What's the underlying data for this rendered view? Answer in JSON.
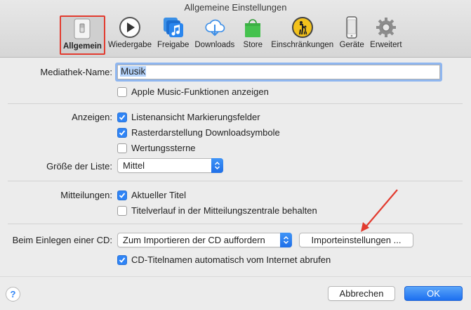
{
  "window": {
    "title": "Allgemeine Einstellungen"
  },
  "tabs": [
    {
      "label": "Allgemein",
      "icon": "switch-icon"
    },
    {
      "label": "Wiedergabe",
      "icon": "play-icon"
    },
    {
      "label": "Freigabe",
      "icon": "music-share-icon"
    },
    {
      "label": "Downloads",
      "icon": "cloud-download-icon"
    },
    {
      "label": "Store",
      "icon": "shopping-bag-icon"
    },
    {
      "label": "Einschränkungen",
      "icon": "parental-icon"
    },
    {
      "label": "Geräte",
      "icon": "phone-icon"
    },
    {
      "label": "Erweitert",
      "icon": "gear-icon"
    }
  ],
  "library": {
    "label": "Mediathek-Name:",
    "value": "Musik",
    "apple_music": "Apple Music-Funktionen anzeigen"
  },
  "show": {
    "label": "Anzeigen:",
    "options": [
      {
        "text": "Listenansicht Markierungsfelder",
        "checked": true
      },
      {
        "text": "Rasterdarstellung Downloadsymbole",
        "checked": true
      },
      {
        "text": "Wertungssterne",
        "checked": false
      }
    ]
  },
  "list_size": {
    "label": "Größe der Liste:",
    "value": "Mittel"
  },
  "notifications": {
    "label": "Mitteilungen:",
    "options": [
      {
        "text": "Aktueller Titel",
        "checked": true
      },
      {
        "text": "Titelverlauf in der Mitteilungszentrale behalten",
        "checked": false
      }
    ]
  },
  "cd": {
    "label": "Beim Einlegen einer CD:",
    "value": "Zum Importieren der CD auffordern",
    "import_button": "Importeinstellungen ...",
    "auto_names": "CD-Titelnamen automatisch vom Internet abrufen"
  },
  "footer": {
    "help": "?",
    "cancel": "Abbrechen",
    "ok": "OK"
  },
  "colors": {
    "accent": "#2f84f6",
    "highlight": "#e23b2f"
  }
}
